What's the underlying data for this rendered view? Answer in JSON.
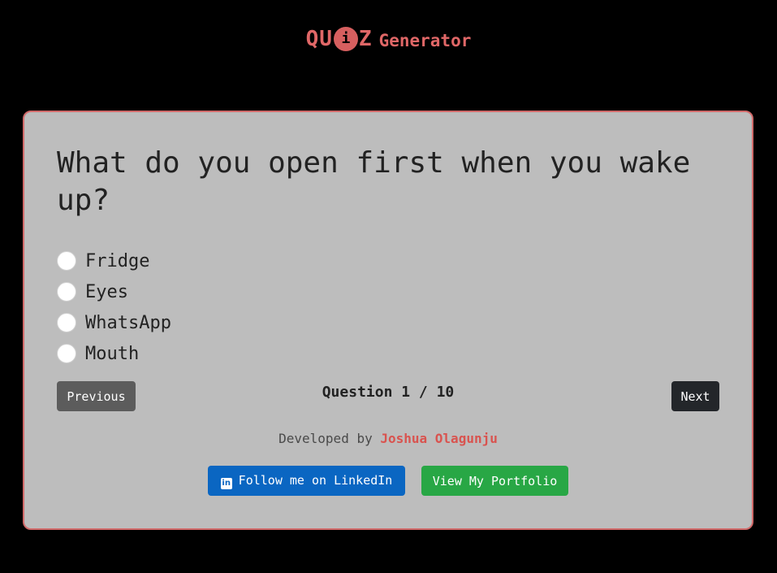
{
  "header": {
    "logo_prefix": "QU",
    "logo_i": "i",
    "logo_suffix": "Z",
    "subtitle": "Generator"
  },
  "quiz": {
    "question": "What do you open first when you wake up?",
    "options": [
      "Fridge",
      "Eyes",
      "WhatsApp",
      "Mouth"
    ],
    "selected": null,
    "counter": "Question 1 / 10",
    "current": 1,
    "total": 10,
    "prev_label": "Previous",
    "next_label": "Next"
  },
  "footer": {
    "developed_by": "Developed by",
    "author": "Joshua Olagunju",
    "linkedin_icon_text": "in",
    "linkedin_label": "Follow me on LinkedIn",
    "portfolio_label": "View My Portfolio"
  },
  "colors": {
    "background": "#000000",
    "card": "#bdbdbd",
    "accent": "#d9534f",
    "linkedin": "#0a66c2",
    "portfolio": "#28a745"
  }
}
